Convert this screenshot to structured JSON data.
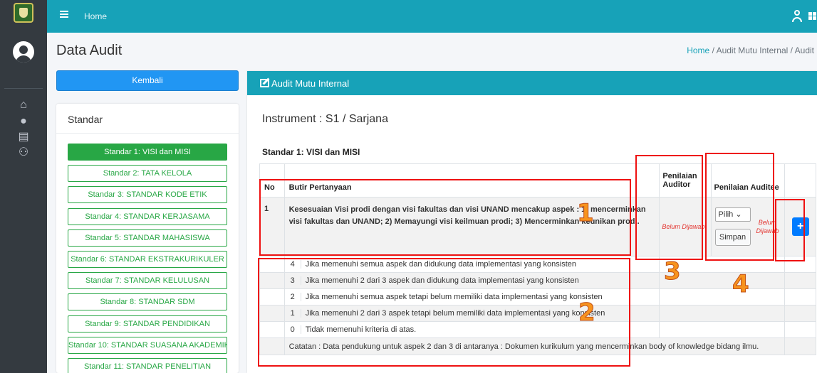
{
  "topbar": {
    "home_label": "Home"
  },
  "header": {
    "title": "Data Audit",
    "breadcrumb_home": "Home",
    "breadcrumb_rest": " /  Audit Mutu Internal / Audit"
  },
  "sidebar": {
    "back_label": "Kembali",
    "card_title": "Standar",
    "items": [
      "Standar 1: VISI dan MISI",
      "Standar 2: TATA KELOLA",
      "Standar 3: STANDAR KODE ETIK",
      "Standar 4: STANDAR KERJASAMA",
      "Standar 5: STANDAR MAHASISWA",
      "Standar 6: STANDAR EKSTRAKURIKULER",
      "Standar 7: STANDAR KELULUSAN",
      "Standar 8: STANDAR SDM",
      "Standar 9: STANDAR PENDIDIKAN",
      "Standar 10: STANDAR SUASANA AKADEMIK",
      "Standar 11: STANDAR PENELITIAN"
    ]
  },
  "main": {
    "card_title": "Audit Mutu Internal",
    "instrument": "Instrument : S1 / Sarjana",
    "standard_title": "Standar 1: VISI dan MISI",
    "table": {
      "col_no": "No",
      "col_butir": "Butir Pertanyaan",
      "col_auditor_line1": "Penilaian",
      "col_auditor_line2": "Auditor",
      "col_auditee": "Penilaian Auditee",
      "row_no": "1",
      "question": "Kesesuaian Visi prodi dengan visi fakultas dan visi UNAND mencakup aspek : 1) mencerminkan visi fakultas dan UNAND; 2) Memayungi visi keilmuan prodi; 3) Mencerminkan keunikan prodi.",
      "auditor_status": "Belum Dijawab",
      "select_value": "Pilih",
      "save_label": "Simpan",
      "auditee_status_line1": "Belum",
      "auditee_status_line2": "Dijawab",
      "add_label": "+",
      "criteria": [
        {
          "score": "4",
          "text": "Jika memenuhi semua aspek dan didukung data implementasi yang konsisten"
        },
        {
          "score": "3",
          "text": "Jika memenuhi 2 dari 3 aspek dan didukung data implementasi yang konsisten"
        },
        {
          "score": "2",
          "text": "Jika memenuhi semua aspek tetapi belum memiliki data implementasi yang konsisten"
        },
        {
          "score": "1",
          "text": "Jika memenuhi 2 dari 3 aspek tetapi belum memiliki data implementasi yang konsisten"
        },
        {
          "score": "0",
          "text": "Tidak memenuhi kriteria di atas."
        }
      ],
      "note": "Catatan : Data pendukung untuk aspek 2 dan 3 di antaranya : Dokumen kurikulum yang mencerminkan body of knowledge bidang ilmu."
    }
  },
  "annotations": {
    "labels": [
      "1",
      "2",
      "3",
      "4"
    ],
    "box_color": "#ee1111",
    "number_color": "#f7931e"
  },
  "colors": {
    "topbar": "#17a2b8",
    "rail": "#343a40",
    "back_button": "#2196f3",
    "standard_green": "#28a745",
    "add_button": "#007bff"
  }
}
